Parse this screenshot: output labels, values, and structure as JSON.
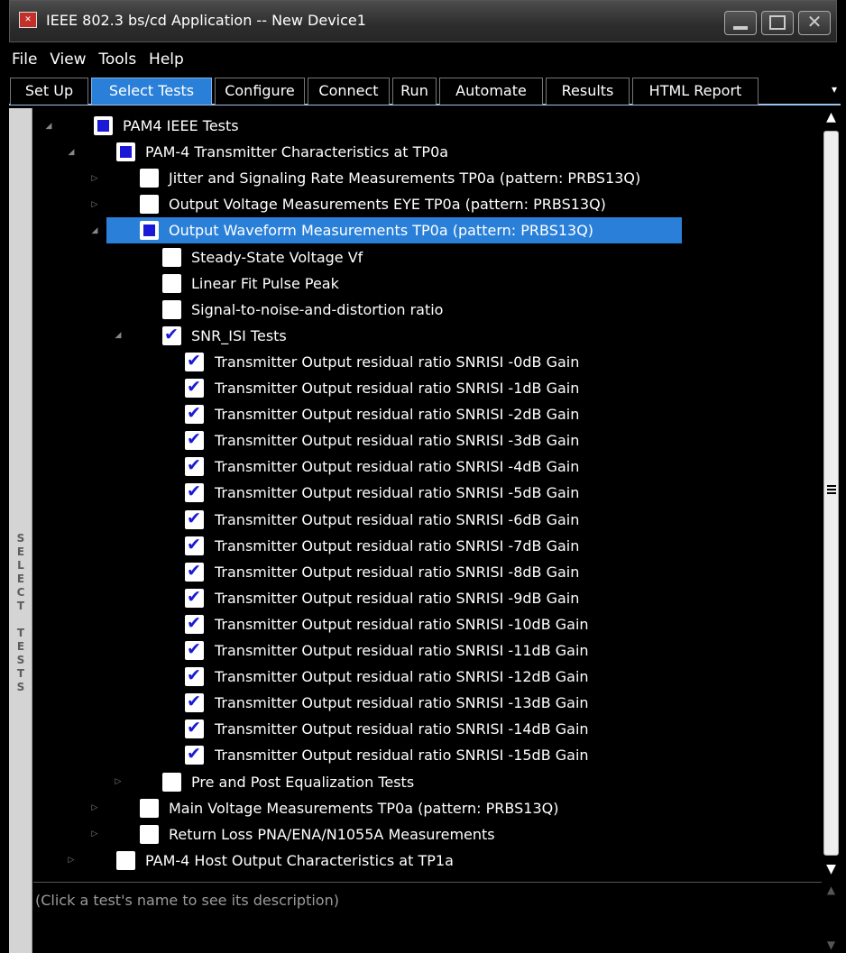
{
  "window": {
    "title": "IEEE 802.3 bs/cd Application -- New Device1"
  },
  "menu": [
    "File",
    "View",
    "Tools",
    "Help"
  ],
  "tabs": [
    {
      "label": "Set Up",
      "active": false
    },
    {
      "label": "Select Tests",
      "active": true
    },
    {
      "label": "Configure",
      "active": false
    },
    {
      "label": "Connect",
      "active": false
    },
    {
      "label": "Run",
      "active": false
    },
    {
      "label": "Automate",
      "active": false
    },
    {
      "label": "Results",
      "active": false
    },
    {
      "label": "HTML Report",
      "active": false
    }
  ],
  "side_label": "SELECT TESTS",
  "tree": [
    {
      "label": "PAM4 IEEE Tests",
      "level": 0,
      "state": "partial",
      "expander": "expanded"
    },
    {
      "label": "PAM-4 Transmitter Characteristics at TP0a",
      "level": 1,
      "state": "partial",
      "expander": "expanded"
    },
    {
      "label": "Jitter and Signaling Rate Measurements TP0a (pattern: PRBS13Q)",
      "level": 2,
      "state": "unchecked",
      "expander": "collapsed"
    },
    {
      "label": "Output Voltage Measurements EYE TP0a (pattern: PRBS13Q)",
      "level": 2,
      "state": "unchecked",
      "expander": "collapsed"
    },
    {
      "label": "Output Waveform Measurements TP0a (pattern: PRBS13Q)",
      "level": 2,
      "state": "partial",
      "expander": "expanded",
      "selected": true
    },
    {
      "label": "Steady-State Voltage Vf",
      "level": 3,
      "state": "unchecked",
      "expander": "none"
    },
    {
      "label": "Linear Fit Pulse Peak",
      "level": 3,
      "state": "unchecked",
      "expander": "none"
    },
    {
      "label": "Signal-to-noise-and-distortion ratio",
      "level": 3,
      "state": "unchecked",
      "expander": "none"
    },
    {
      "label": "SNR_ISI Tests",
      "level": 3,
      "state": "checked",
      "expander": "expanded"
    },
    {
      "label": "Transmitter Output residual ratio SNRISI -0dB Gain",
      "level": 4,
      "state": "checked",
      "expander": "none"
    },
    {
      "label": "Transmitter Output residual ratio SNRISI -1dB Gain",
      "level": 4,
      "state": "checked",
      "expander": "none"
    },
    {
      "label": "Transmitter Output residual ratio SNRISI -2dB Gain",
      "level": 4,
      "state": "checked",
      "expander": "none"
    },
    {
      "label": "Transmitter Output residual ratio SNRISI -3dB Gain",
      "level": 4,
      "state": "checked",
      "expander": "none"
    },
    {
      "label": "Transmitter Output residual ratio SNRISI -4dB Gain",
      "level": 4,
      "state": "checked",
      "expander": "none"
    },
    {
      "label": "Transmitter Output residual ratio SNRISI -5dB Gain",
      "level": 4,
      "state": "checked",
      "expander": "none"
    },
    {
      "label": "Transmitter Output residual ratio SNRISI -6dB Gain",
      "level": 4,
      "state": "checked",
      "expander": "none"
    },
    {
      "label": "Transmitter Output residual ratio SNRISI -7dB Gain",
      "level": 4,
      "state": "checked",
      "expander": "none"
    },
    {
      "label": "Transmitter Output residual ratio SNRISI -8dB Gain",
      "level": 4,
      "state": "checked",
      "expander": "none"
    },
    {
      "label": "Transmitter Output residual ratio SNRISI -9dB Gain",
      "level": 4,
      "state": "checked",
      "expander": "none"
    },
    {
      "label": "Transmitter Output residual ratio SNRISI -10dB Gain",
      "level": 4,
      "state": "checked",
      "expander": "none"
    },
    {
      "label": "Transmitter Output residual ratio SNRISI -11dB Gain",
      "level": 4,
      "state": "checked",
      "expander": "none"
    },
    {
      "label": "Transmitter Output residual ratio SNRISI -12dB Gain",
      "level": 4,
      "state": "checked",
      "expander": "none"
    },
    {
      "label": "Transmitter Output residual ratio SNRISI -13dB Gain",
      "level": 4,
      "state": "checked",
      "expander": "none"
    },
    {
      "label": "Transmitter Output residual ratio SNRISI -14dB Gain",
      "level": 4,
      "state": "checked",
      "expander": "none"
    },
    {
      "label": "Transmitter Output residual ratio SNRISI -15dB Gain",
      "level": 4,
      "state": "checked",
      "expander": "none"
    },
    {
      "label": "Pre and Post Equalization Tests",
      "level": 3,
      "state": "unchecked",
      "expander": "collapsed"
    },
    {
      "label": "Main Voltage Measurements TP0a (pattern: PRBS13Q)",
      "level": 2,
      "state": "unchecked",
      "expander": "collapsed"
    },
    {
      "label": "Return Loss PNA/ENA/N1055A Measurements",
      "level": 2,
      "state": "unchecked",
      "expander": "collapsed"
    },
    {
      "label": "PAM-4 Host Output Characteristics at TP1a",
      "level": 1,
      "state": "unchecked",
      "expander": "collapsed"
    }
  ],
  "description": {
    "placeholder": "(Click a test's name to see its description)"
  },
  "icons": {
    "app": "app-logo-icon",
    "expanded": "triangle-expanded-icon",
    "collapsed": "triangle-collapsed-icon"
  },
  "colors": {
    "selection": "#2a80d9",
    "checkbox_mark": "#1a1ad6",
    "background": "#000000"
  }
}
